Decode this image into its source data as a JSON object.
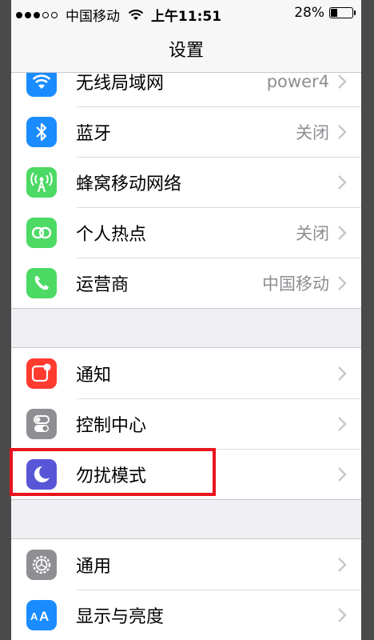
{
  "status": {
    "carrier": "中国移动",
    "time": "上午11:51",
    "battery": "28%",
    "battery_level": 0.28
  },
  "nav": {
    "title": "设置"
  },
  "groups": [
    {
      "items": [
        {
          "label": "无线局域网",
          "value": "power4",
          "icon": "wifi-icon",
          "color": "#1a8cff"
        },
        {
          "label": "蓝牙",
          "value": "关闭",
          "icon": "bluetooth-icon",
          "color": "#1a8cff"
        },
        {
          "label": "蜂窝移动网络",
          "value": "",
          "icon": "cellular-antenna-icon",
          "color": "#4cd964"
        },
        {
          "label": "个人热点",
          "value": "关闭",
          "icon": "hotspot-icon",
          "color": "#4cd964"
        },
        {
          "label": "运营商",
          "value": "中国移动",
          "icon": "phone-icon",
          "color": "#4cd964"
        }
      ]
    },
    {
      "items": [
        {
          "label": "通知",
          "value": "",
          "icon": "notification-icon",
          "color": "#ff3b30"
        },
        {
          "label": "控制中心",
          "value": "",
          "icon": "toggle-switches-icon",
          "color": "#8e8e93"
        },
        {
          "label": "勿扰模式",
          "value": "",
          "icon": "moon-icon",
          "color": "#5856d6"
        }
      ]
    },
    {
      "items": [
        {
          "label": "通用",
          "value": "",
          "icon": "gear-icon",
          "color": "#8e8e93"
        },
        {
          "label": "显示与亮度",
          "value": "",
          "icon": "text-size-icon",
          "color": "#1a8cff"
        }
      ]
    }
  ]
}
